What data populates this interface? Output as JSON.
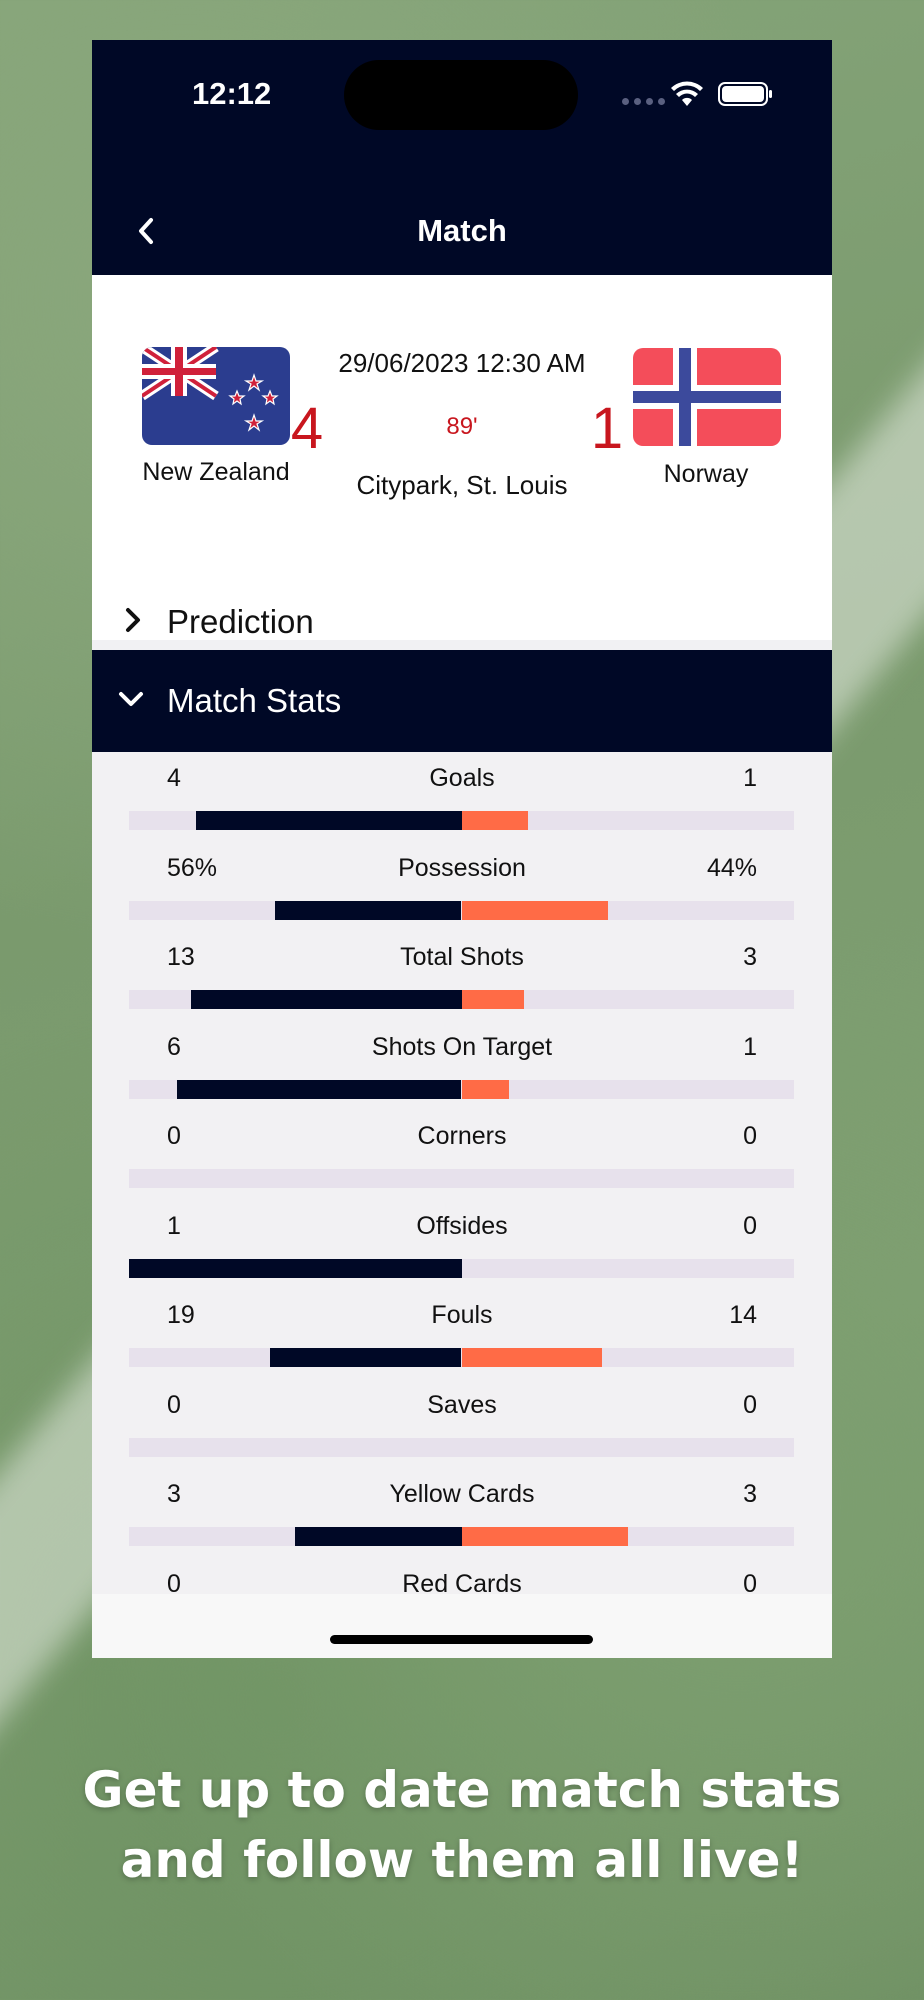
{
  "status_bar": {
    "time": "12:12"
  },
  "nav": {
    "title": "Match",
    "back_icon": "chevron-left-icon"
  },
  "match": {
    "date": "29/06/2023 12:30 AM",
    "home_team": "New Zealand",
    "away_team": "Norway",
    "home_score": "4",
    "away_score": "1",
    "minute": "89'",
    "venue": "Citypark, St. Louis"
  },
  "sections": {
    "prediction_label": "Prediction",
    "stats_label": "Match Stats"
  },
  "stats": [
    {
      "label": "Goals",
      "home": "4",
      "away": "1",
      "home_frac": 0.8,
      "away_frac": 0.2
    },
    {
      "label": "Possession",
      "home": "56%",
      "away": "44%",
      "home_frac": 0.56,
      "away_frac": 0.44
    },
    {
      "label": "Total Shots",
      "home": "13",
      "away": "3",
      "home_frac": 0.8125,
      "away_frac": 0.1875
    },
    {
      "label": "Shots On Target",
      "home": "6",
      "away": "1",
      "home_frac": 0.857,
      "away_frac": 0.143
    },
    {
      "label": "Corners",
      "home": "0",
      "away": "0",
      "home_frac": 0,
      "away_frac": 0
    },
    {
      "label": "Offsides",
      "home": "1",
      "away": "0",
      "home_frac": 1,
      "away_frac": 0
    },
    {
      "label": "Fouls",
      "home": "19",
      "away": "14",
      "home_frac": 0.576,
      "away_frac": 0.424
    },
    {
      "label": "Saves",
      "home": "0",
      "away": "0",
      "home_frac": 0,
      "away_frac": 0
    },
    {
      "label": "Yellow Cards",
      "home": "3",
      "away": "3",
      "home_frac": 0.5,
      "away_frac": 0.5
    },
    {
      "label": "Red Cards",
      "home": "0",
      "away": "0",
      "home_frac": 0,
      "away_frac": 0
    }
  ],
  "colors": {
    "navy": "#000826",
    "orange": "#ff6b46",
    "score_red": "#c8161e",
    "track": "#e7e1ec"
  },
  "promo": {
    "line1": "Get up to date match stats",
    "line2": "and follow them all live!"
  }
}
